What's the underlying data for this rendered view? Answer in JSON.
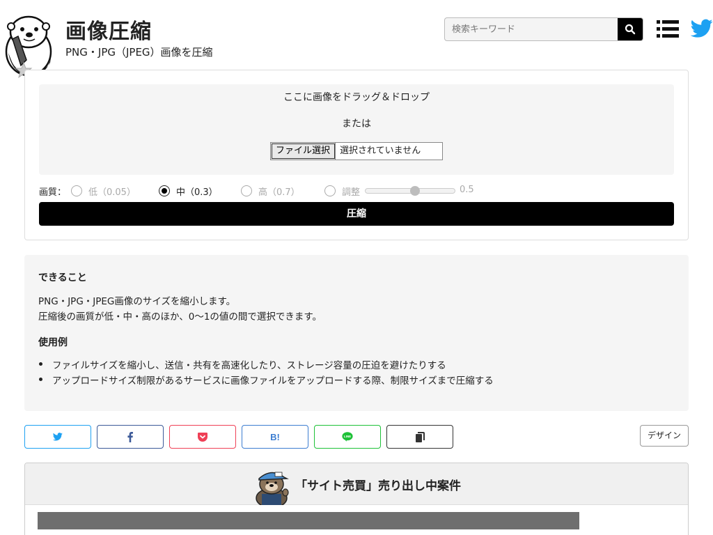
{
  "header": {
    "title": "画像圧縮",
    "subtitle": "PNG・JPG（JPEG）画像を圧縮",
    "search_placeholder": "検索キーワード"
  },
  "upload": {
    "drop_text": "ここに画像をドラッグ＆ドロップ",
    "or_text": "または",
    "file_button": "ファイル選択",
    "file_status": "選択されていません"
  },
  "quality": {
    "label": "画質：",
    "options": [
      {
        "label": "低（0.05）",
        "checked": false
      },
      {
        "label": "中（0.3）",
        "checked": true
      },
      {
        "label": "高（0.7）",
        "checked": false
      },
      {
        "label": "調整",
        "checked": false
      }
    ],
    "slider_value": "0.5",
    "slider_fraction": 0.5
  },
  "compress_button": "圧縮",
  "info": {
    "heading1": "できること",
    "p1": "PNG・JPG・JPEG画像のサイズを縮小します。",
    "p2": "圧縮後の画質が低・中・高のほか、0〜1の値の間で選択できます。",
    "heading2": "使用例",
    "items": [
      "ファイルサイズを縮小し、送信・共有を高速化したり、ストレージ容量の圧迫を避けたりする",
      "アップロードサイズ制限があるサービスに画像ファイルをアップロードする際、制限サイズまで圧縮する"
    ]
  },
  "share": {
    "buttons": [
      {
        "name": "twitter",
        "icon": "twitter-icon",
        "color": "#1da1f2"
      },
      {
        "name": "facebook",
        "icon": "facebook-icon",
        "color": "#3b5998"
      },
      {
        "name": "pocket",
        "icon": "pocket-icon",
        "color": "#ef4056"
      },
      {
        "name": "hatena",
        "icon": "hatena-bookmark-icon",
        "label": "B!",
        "color": "#3c7dd1"
      },
      {
        "name": "line",
        "icon": "line-icon",
        "color": "#1dc137"
      },
      {
        "name": "copy",
        "icon": "copy-icon",
        "color": "#333333"
      }
    ],
    "design_button": "デザイン"
  },
  "sale": {
    "title": "「サイト売買」売り出し中案件"
  }
}
